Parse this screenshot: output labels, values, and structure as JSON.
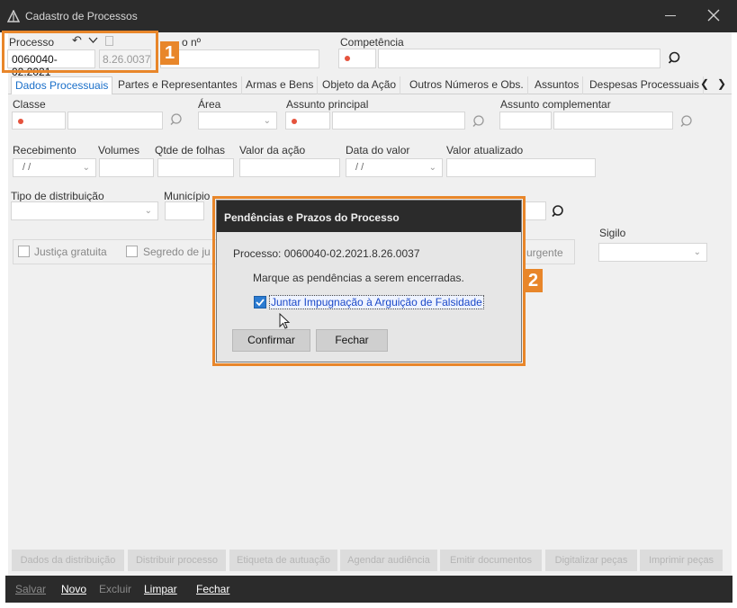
{
  "window": {
    "title": "Cadastro de Processos"
  },
  "header": {
    "processo_label": "Processo",
    "processo_value": "0060040-02.2021",
    "processo_suffix": "8.26.0037",
    "pedido_label": "o nº",
    "competencia_label": "Competência"
  },
  "tabs": [
    {
      "label": "Dados Processuais"
    },
    {
      "label": "Partes e Representantes"
    },
    {
      "label": "Armas e Bens"
    },
    {
      "label": "Objeto da Ação"
    },
    {
      "label": "Outros Números e Obs."
    },
    {
      "label": "Assuntos"
    },
    {
      "label": "Despesas Processuais"
    }
  ],
  "form": {
    "classe_label": "Classe",
    "area_label": "Área",
    "assunto_principal_label": "Assunto principal",
    "assunto_complementar_label": "Assunto complementar",
    "recebimento_label": "Recebimento",
    "recebimento_value": "/ /",
    "volumes_label": "Volumes",
    "folhas_label": "Qtde de folhas",
    "valor_acao_label": "Valor da ação",
    "data_valor_label": "Data do valor",
    "data_valor_value": "/ /",
    "valor_atualizado_label": "Valor atualizado",
    "tipo_distribuicao_label": "Tipo de distribuição",
    "municipio_label": "Município",
    "sigilo_label": "Sigilo",
    "justica_gratuita_label": "Justiça gratuita",
    "segredo_label": "Segredo de ju",
    "urgente_label": "urgente"
  },
  "dialog": {
    "title": "Pendências e Prazos do Processo",
    "processo_text": "Processo: 0060040-02.2021.8.26.0037",
    "instruction": "Marque as pendências a serem encerradas.",
    "item_label": "Juntar Impugnação à Arguição de Falsidade",
    "item_checked": true,
    "confirm_label": "Confirmar",
    "close_label": "Fechar"
  },
  "disabled_buttons": [
    {
      "label": "Dados da distribuição"
    },
    {
      "label": "Distribuir processo"
    },
    {
      "label": "Etiqueta de autuação"
    },
    {
      "label": "Agendar audiência"
    },
    {
      "label": "Emitir documentos"
    },
    {
      "label": "Digitalizar peças"
    },
    {
      "label": "Imprimir peças"
    }
  ],
  "bottom_bar": {
    "salvar": "Salvar",
    "novo": "Novo",
    "excluir": "Excluir",
    "limpar": "Limpar",
    "fechar": "Fechar"
  },
  "badges": {
    "one": "1",
    "two": "2"
  },
  "colors": {
    "highlight": "#e8862a",
    "titlebar": "#2b2b2b",
    "link": "#1a6fc9"
  }
}
